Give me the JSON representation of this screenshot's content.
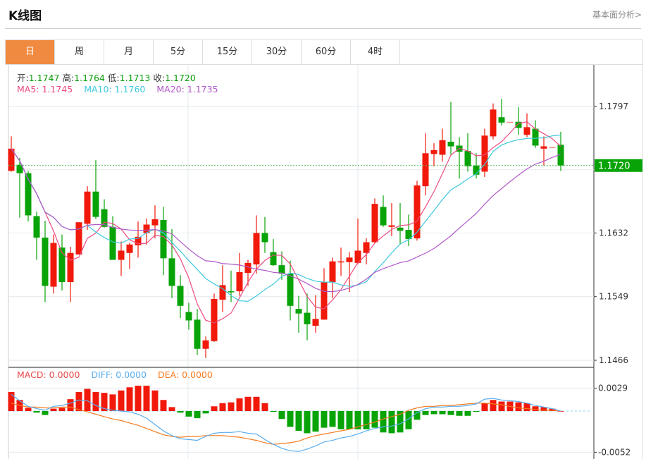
{
  "header": {
    "title": "K线图",
    "more_link": "基本面分析>"
  },
  "tabs": [
    {
      "label": "日",
      "active": true
    },
    {
      "label": "周"
    },
    {
      "label": "月"
    },
    {
      "label": "5分"
    },
    {
      "label": "15分"
    },
    {
      "label": "30分"
    },
    {
      "label": "60分"
    },
    {
      "label": "4时"
    }
  ],
  "ohlc_legend": {
    "open_label": "开:",
    "open": "1.1747",
    "high_label": "高:",
    "high": "1.1764",
    "low_label": "低:",
    "low": "1.1713",
    "close_label": "收:",
    "close": "1.1720"
  },
  "ma_legend": {
    "ma5": "MA5: 1.1745",
    "ma10": "MA10: 1.1760",
    "ma20": "MA20: 1.1735"
  },
  "macd_legend": {
    "macd": "MACD: 0.0000",
    "diff": "DIFF: 0.0000",
    "dea": "DEA: 0.0000"
  },
  "colors": {
    "up": "#F0190A",
    "down": "#07A307",
    "doji": "#F08A8A",
    "ma5": "#EC4B80",
    "ma10": "#3DC9DD",
    "ma20": "#B058C8",
    "diff": "#5AAEF0",
    "dea": "#F57A20",
    "accent": "#F08A40"
  },
  "chart_data": [
    {
      "type": "candlestick",
      "price_ticks": [
        "1.1797",
        "1.1632",
        "1.1549",
        "1.1466"
      ],
      "ylim": [
        1.1466,
        1.1797
      ],
      "last_price_label": "1.1720",
      "last_price": 1.172,
      "moving_averages": [
        5,
        10,
        20
      ],
      "ohlc": [
        [
          1.1713,
          1.1758,
          1.1712,
          1.1742
        ],
        [
          1.1721,
          1.173,
          1.1652,
          1.171
        ],
        [
          1.171,
          1.1713,
          1.1647,
          1.1655
        ],
        [
          1.1654,
          1.166,
          1.1597,
          1.1626
        ],
        [
          1.1626,
          1.1648,
          1.1542,
          1.1563
        ],
        [
          1.1562,
          1.163,
          1.1553,
          1.1619
        ],
        [
          1.1613,
          1.163,
          1.1557,
          1.1568
        ],
        [
          1.1568,
          1.1614,
          1.1542,
          1.1606
        ],
        [
          1.1604,
          1.1646,
          1.1604,
          1.1646
        ],
        [
          1.1644,
          1.1693,
          1.1636,
          1.1686
        ],
        [
          1.1686,
          1.1727,
          1.165,
          1.1653
        ],
        [
          1.1663,
          1.1676,
          1.1639,
          1.164
        ],
        [
          1.164,
          1.1654,
          1.1597,
          1.1597
        ],
        [
          1.1597,
          1.1621,
          1.1576,
          1.1609
        ],
        [
          1.1606,
          1.1619,
          1.1585,
          1.1617
        ],
        [
          1.1616,
          1.1647,
          1.16,
          1.1627
        ],
        [
          1.1632,
          1.1651,
          1.1617,
          1.1643
        ],
        [
          1.1642,
          1.1668,
          1.1625,
          1.165
        ],
        [
          1.1649,
          1.1666,
          1.1577,
          1.1599
        ],
        [
          1.1599,
          1.1637,
          1.1547,
          1.1563
        ],
        [
          1.1563,
          1.1577,
          1.1521,
          1.1537
        ],
        [
          1.1529,
          1.1541,
          1.1506,
          1.1518
        ],
        [
          1.1519,
          1.1533,
          1.1473,
          1.1481
        ],
        [
          1.1481,
          1.1497,
          1.1469,
          1.1492
        ],
        [
          1.1491,
          1.1553,
          1.149,
          1.1546
        ],
        [
          1.1545,
          1.159,
          1.1529,
          1.1564
        ],
        [
          1.1556,
          1.1583,
          1.1542,
          1.1555
        ],
        [
          1.1556,
          1.1606,
          1.155,
          1.1581
        ],
        [
          1.158,
          1.1597,
          1.1563,
          1.1593
        ],
        [
          1.1591,
          1.1655,
          1.1579,
          1.1632
        ],
        [
          1.1632,
          1.1653,
          1.1606,
          1.162
        ],
        [
          1.1607,
          1.1624,
          1.1589,
          1.159
        ],
        [
          1.159,
          1.1608,
          1.1571,
          1.1579
        ],
        [
          1.1579,
          1.1596,
          1.1518,
          1.1537
        ],
        [
          1.1533,
          1.155,
          1.1502,
          1.1527
        ],
        [
          1.1528,
          1.1553,
          1.1492,
          1.1513
        ],
        [
          1.1511,
          1.1551,
          1.1502,
          1.152
        ],
        [
          1.1519,
          1.1586,
          1.1519,
          1.1568
        ],
        [
          1.1568,
          1.16,
          1.1547,
          1.1595
        ],
        [
          1.1594,
          1.1613,
          1.1576,
          1.1595
        ],
        [
          1.1594,
          1.1607,
          1.1555,
          1.16
        ],
        [
          1.1593,
          1.1651,
          1.1591,
          1.1609
        ],
        [
          1.1606,
          1.1625,
          1.1591,
          1.162
        ],
        [
          1.162,
          1.1677,
          1.1619,
          1.167
        ],
        [
          1.1666,
          1.1681,
          1.164,
          1.1642
        ],
        [
          1.164,
          1.1671,
          1.1628,
          1.1642
        ],
        [
          1.1639,
          1.1671,
          1.1617,
          1.1635
        ],
        [
          1.1636,
          1.1656,
          1.1615,
          1.1624
        ],
        [
          1.1625,
          1.17,
          1.1622,
          1.1694
        ],
        [
          1.1693,
          1.1762,
          1.1681,
          1.1736
        ],
        [
          1.1735,
          1.1749,
          1.1719,
          1.174
        ],
        [
          1.1734,
          1.1768,
          1.1725,
          1.1753
        ],
        [
          1.1751,
          1.1803,
          1.1734,
          1.1745
        ],
        [
          1.1746,
          1.1757,
          1.1703,
          1.1738
        ],
        [
          1.1739,
          1.1762,
          1.1712,
          1.1719
        ],
        [
          1.172,
          1.1736,
          1.1703,
          1.1708
        ],
        [
          1.1712,
          1.1768,
          1.1705,
          1.1759
        ],
        [
          1.1758,
          1.1801,
          1.1754,
          1.1793
        ],
        [
          1.1783,
          1.1807,
          1.1772,
          1.1776
        ],
        [
          1.1777,
          1.1777,
          1.1777,
          1.1777
        ],
        [
          1.1777,
          1.1796,
          1.176,
          1.1769
        ],
        [
          1.176,
          1.1788,
          1.1757,
          1.177
        ],
        [
          1.1768,
          1.1779,
          1.1743,
          1.1746
        ],
        [
          1.1742,
          1.1758,
          1.172,
          1.1745
        ],
        [
          1.1744,
          1.1744,
          1.1744,
          1.1744
        ],
        [
          1.1747,
          1.1764,
          1.1713,
          1.172
        ]
      ]
    },
    {
      "type": "macd",
      "ticks": [
        "0.0029",
        "-0.0052"
      ],
      "ylim": [
        -0.0052,
        0.0029
      ],
      "macd": [
        0.0024,
        0.0014,
        0.0004,
        -0.0002,
        -0.0005,
        0.0003,
        0.0004,
        0.0015,
        0.0024,
        0.0028,
        0.0024,
        0.0023,
        0.0021,
        0.0026,
        0.003,
        0.0032,
        0.0032,
        0.0026,
        0.0014,
        0.0005,
        -0.0002,
        -0.0007,
        -0.0009,
        -0.0003,
        0.0006,
        0.001,
        0.0011,
        0.0016,
        0.0018,
        0.0018,
        0.001,
        -0.0001,
        -0.001,
        -0.002,
        -0.0025,
        -0.0028,
        -0.0026,
        -0.0021,
        -0.002,
        -0.0023,
        -0.0023,
        -0.0023,
        -0.0023,
        -0.0021,
        -0.0027,
        -0.0028,
        -0.0027,
        -0.0023,
        -0.0011,
        -0.0005,
        -0.0004,
        -0.0004,
        -0.0005,
        -0.0006,
        -0.0006,
        -0.0001,
        0.001,
        0.0014,
        0.0012,
        0.0012,
        0.0011,
        0.001,
        0.0006,
        0.0005,
        0.0003,
        0.0
      ],
      "diff": [
        0.0021,
        0.0013,
        0.0006,
        0.0003,
        0.0001,
        0.0006,
        0.0007,
        0.001,
        0.0014,
        0.0013,
        0.0007,
        0.0003,
        0.0001,
        0.0,
        -0.0001,
        -0.0004,
        -0.0009,
        -0.0017,
        -0.0025,
        -0.0031,
        -0.0035,
        -0.0036,
        -0.0037,
        -0.0032,
        -0.0028,
        -0.0027,
        -0.0027,
        -0.0026,
        -0.0028,
        -0.0029,
        -0.0036,
        -0.0042,
        -0.0047,
        -0.005,
        -0.0051,
        -0.0048,
        -0.0044,
        -0.0039,
        -0.0037,
        -0.0034,
        -0.0032,
        -0.0029,
        -0.0025,
        -0.0022,
        -0.002,
        -0.0019,
        -0.0016,
        -0.001,
        -0.0002,
        0.0003,
        0.0005,
        0.0005,
        0.0006,
        0.0006,
        0.0007,
        0.0009,
        0.0015,
        0.0016,
        0.0014,
        0.0013,
        0.0012,
        0.001,
        0.0007,
        0.0005,
        0.0003,
        0.0
      ],
      "dea": [
        0.001,
        0.0007,
        0.0005,
        0.0005,
        0.0004,
        0.0004,
        0.0005,
        0.0005,
        0.0002,
        -0.0001,
        -0.0004,
        -0.0007,
        -0.001,
        -0.0012,
        -0.0015,
        -0.0018,
        -0.0022,
        -0.0026,
        -0.003,
        -0.0032,
        -0.0033,
        -0.0032,
        -0.0032,
        -0.0031,
        -0.0031,
        -0.0031,
        -0.0032,
        -0.0033,
        -0.0035,
        -0.0037,
        -0.004,
        -0.0042,
        -0.0041,
        -0.004,
        -0.0038,
        -0.0034,
        -0.0031,
        -0.0029,
        -0.0027,
        -0.0025,
        -0.0023,
        -0.002,
        -0.0017,
        -0.0014,
        -0.001,
        -0.0007,
        -0.0004,
        0.0001,
        0.0004,
        0.0006,
        0.0006,
        0.0007,
        0.0007,
        0.0008,
        0.0009,
        0.001,
        0.001,
        0.0009,
        0.0008,
        0.0006,
        0.0004,
        0.0003,
        0.0002,
        0.0001,
        0.0001,
        0.0
      ]
    }
  ]
}
